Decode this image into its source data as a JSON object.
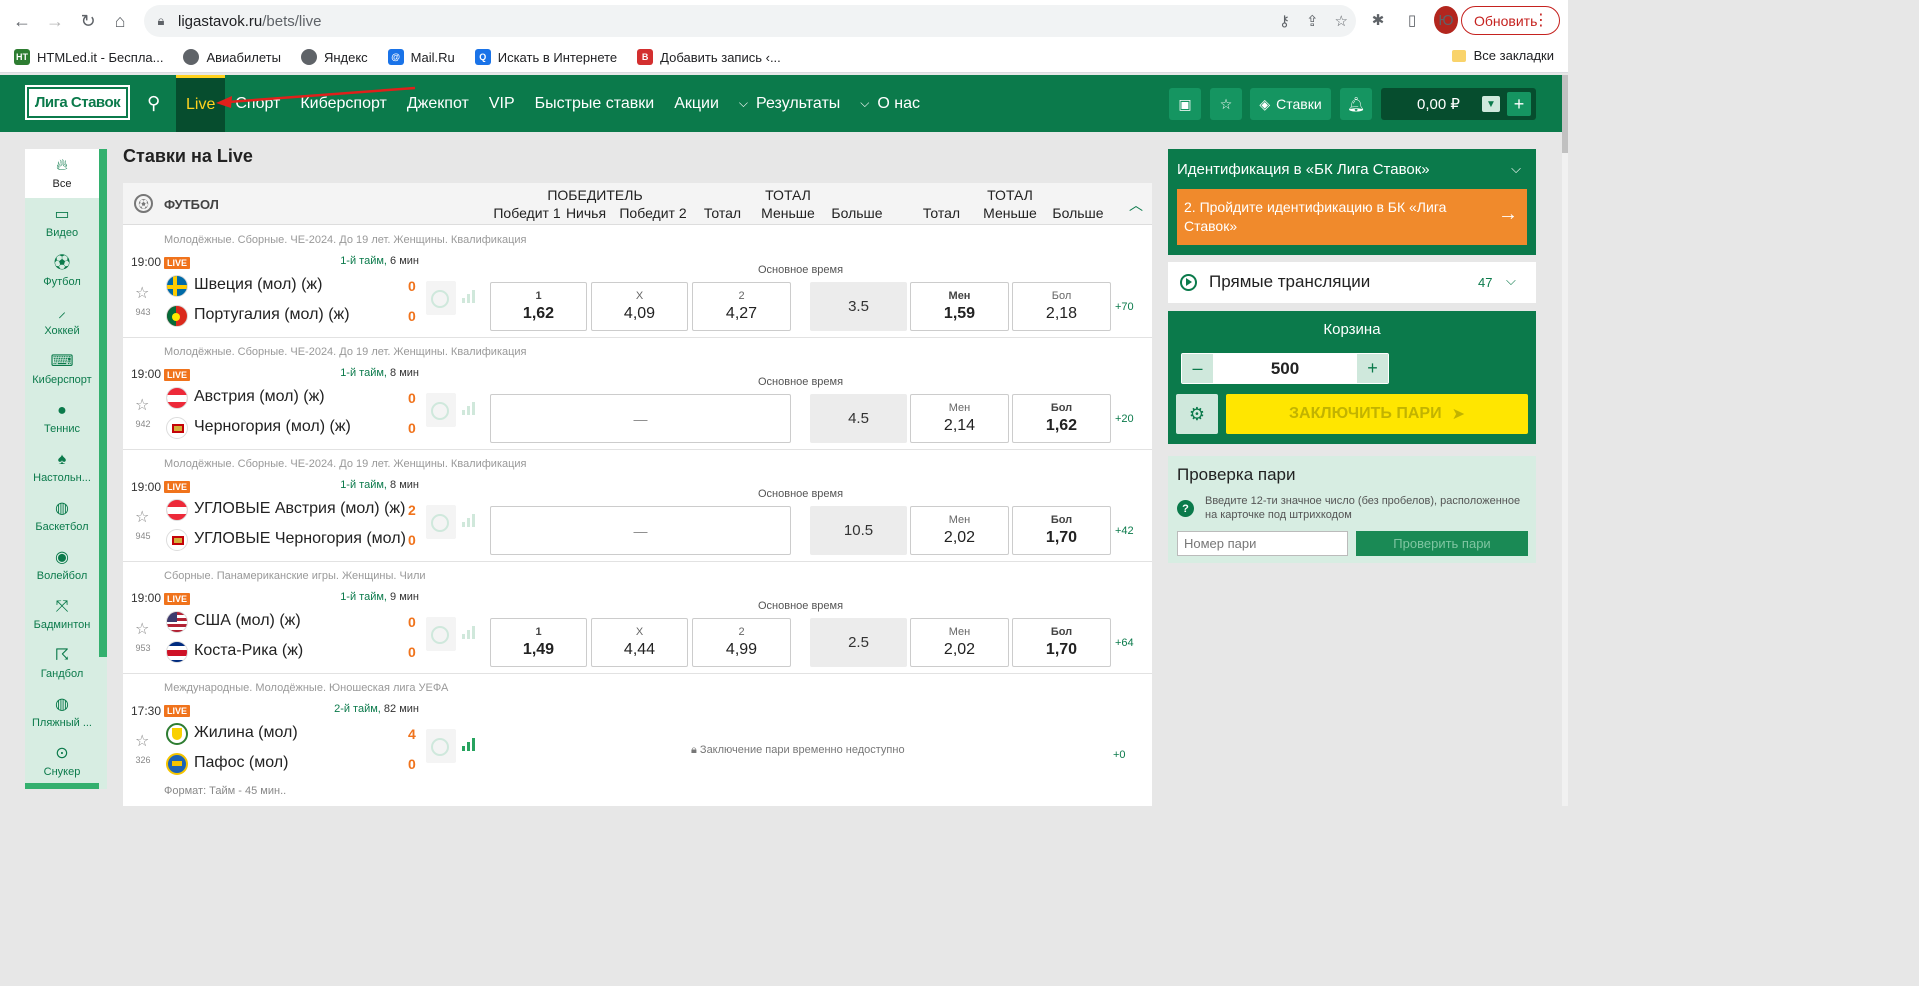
{
  "browser": {
    "url_host": "ligastavok.ru",
    "url_path": "/bets/live",
    "update_label": "Обновить",
    "profile_initial": "Ю",
    "bookmarks": [
      {
        "label": "HTMLed.it - Беспла...",
        "icon": "HT",
        "color": "#2e7d32"
      },
      {
        "label": "Авиабилеты",
        "icon": "globe",
        "color": "#5f6368"
      },
      {
        "label": "Яндекс",
        "icon": "globe",
        "color": "#5f6368"
      },
      {
        "label": "Mail.Ru",
        "icon": "@",
        "color": "#1a73e8"
      },
      {
        "label": "Искать в Интернете",
        "icon": "Q",
        "color": "#1a73e8"
      },
      {
        "label": "Добавить запись ‹...",
        "icon": "B",
        "color": "#d32f2f"
      }
    ],
    "all_bookmarks_label": "Все закладки"
  },
  "header": {
    "logo_text": "Лига Ставок",
    "nav": [
      {
        "label": "Live",
        "active": true
      },
      {
        "label": "Спорт"
      },
      {
        "label": "Киберспорт"
      },
      {
        "label": "Джекпот"
      },
      {
        "label": "VIP"
      },
      {
        "label": "Быстрые ставки"
      },
      {
        "label": "Акции"
      },
      {
        "label": "Результаты",
        "dropdown": true
      },
      {
        "label": "О нас",
        "dropdown": true
      }
    ],
    "bets_label": "Ставки",
    "balance": "0,00 ₽"
  },
  "sidebar": {
    "items": [
      {
        "label": "Все",
        "icon": "fire-icon",
        "active": true
      },
      {
        "label": "Видео",
        "icon": "monitor-icon"
      },
      {
        "label": "Футбол",
        "icon": "football-icon"
      },
      {
        "label": "Хоккей",
        "icon": "hockey-icon"
      },
      {
        "label": "Киберспорт",
        "icon": "gamepad-icon"
      },
      {
        "label": "Теннис",
        "icon": "tennis-icon"
      },
      {
        "label": "Настольн...",
        "icon": "table-tennis-icon"
      },
      {
        "label": "Баскетбол",
        "icon": "basketball-icon"
      },
      {
        "label": "Волейбол",
        "icon": "volleyball-icon"
      },
      {
        "label": "Бадминтон",
        "icon": "badminton-icon"
      },
      {
        "label": "Гандбол",
        "icon": "handball-icon"
      },
      {
        "label": "Пляжный ...",
        "icon": "beach-volleyball-icon"
      },
      {
        "label": "Снукер",
        "icon": "snooker-icon"
      }
    ]
  },
  "main": {
    "title": "Ставки на Live",
    "category": "ФУТБОЛ",
    "columns": {
      "winner_group": "ПОБЕДИТЕЛЬ",
      "win1": "Победит 1",
      "draw": "Ничья",
      "win2": "Победит 2",
      "total_group_1": "ТОТАЛ",
      "total": "Тотал",
      "less": "Меньше",
      "more": "Больше",
      "total_group_2": "ТОТАЛ",
      "total2": "Тотал",
      "less2": "Меньше",
      "more2": "Больше"
    },
    "main_time_label": "Основное время",
    "events": [
      {
        "league": "Молодёжные. Сборные. ЧЕ-2024. До 19 лет. Женщины. Квалификация",
        "time": "19:00",
        "live": "LIVE",
        "period": "1-й тайм,",
        "minute": "6 мин",
        "id": "943",
        "team1": "Швеция (мол) (ж)",
        "team2": "Португалия (мол) (ж)",
        "flag1": "sweden",
        "flag2": "portugal",
        "score1": "0",
        "score2": "0",
        "outcomes": [
          {
            "label": "1",
            "value": "1,62",
            "bold": true
          },
          {
            "label": "X",
            "value": "4,09"
          },
          {
            "label": "2",
            "value": "4,27"
          }
        ],
        "total": "3.5",
        "under": {
          "label": "Мен",
          "value": "1,59",
          "bold": true
        },
        "over": {
          "label": "Бол",
          "value": "2,18"
        },
        "more": "+70"
      },
      {
        "league": "Молодёжные. Сборные. ЧЕ-2024. До 19 лет. Женщины. Квалификация",
        "time": "19:00",
        "live": "LIVE",
        "period": "1-й тайм,",
        "minute": "8 мин",
        "id": "942",
        "team1": "Австрия (мол) (ж)",
        "team2": "Черногория (мол) (ж)",
        "flag1": "austria",
        "flag2": "montenegro",
        "score1": "0",
        "score2": "0",
        "outcomes_empty": "—",
        "total": "4.5",
        "under": {
          "label": "Мен",
          "value": "2,14"
        },
        "over": {
          "label": "Бол",
          "value": "1,62",
          "bold": true
        },
        "more": "+20"
      },
      {
        "league": "Молодёжные. Сборные. ЧЕ-2024. До 19 лет. Женщины. Квалификация",
        "time": "19:00",
        "live": "LIVE",
        "period": "1-й тайм,",
        "minute": "8 мин",
        "id": "945",
        "team1": "УГЛОВЫЕ Австрия (мол) (ж)",
        "team2": "УГЛОВЫЕ Черногория (мол) (...",
        "flag1": "austria",
        "flag2": "montenegro",
        "score1": "2",
        "score2": "0",
        "outcomes_empty": "—",
        "total": "10.5",
        "under": {
          "label": "Мен",
          "value": "2,02"
        },
        "over": {
          "label": "Бол",
          "value": "1,70",
          "bold": true
        },
        "more": "+42"
      },
      {
        "league": "Сборные. Панамериканские игры. Женщины. Чили",
        "time": "19:00",
        "live": "LIVE",
        "period": "1-й тайм,",
        "minute": "9 мин",
        "id": "953",
        "team1": "США (мол) (ж)",
        "team2": "Коста-Рика (ж)",
        "flag1": "usa",
        "flag2": "costarica",
        "score1": "0",
        "score2": "0",
        "outcomes": [
          {
            "label": "1",
            "value": "1,49",
            "bold": true
          },
          {
            "label": "X",
            "value": "4,44"
          },
          {
            "label": "2",
            "value": "4,99"
          }
        ],
        "total": "2.5",
        "under": {
          "label": "Мен",
          "value": "2,02"
        },
        "over": {
          "label": "Бол",
          "value": "1,70",
          "bold": true
        },
        "more": "+64"
      },
      {
        "league": "Международные. Молодёжные. Юношеская лига УЕФА",
        "time": "17:30",
        "live": "LIVE",
        "period": "2-й тайм,",
        "minute": "82 мин",
        "id": "326",
        "team1": "Жилина (мол)",
        "team2": "Пафос (мол)",
        "flag1": "zilina",
        "flag2": "pafos",
        "score1": "4",
        "score2": "0",
        "suspended": "Заключение пари временно недоступно",
        "more": "+0",
        "format": "Формат: Тайм - 45 мин.."
      }
    ]
  },
  "right": {
    "ident_title": "Идентификация в «БК Лига Ставок»",
    "ident_step": "2. Пройдите идентификацию в БК «Лига Ставок»",
    "streams_title": "Прямые трансляции",
    "streams_count": "47",
    "basket_title": "Корзина",
    "stake": "500",
    "place_bet": "ЗАКЛЮЧИТЬ ПАРИ",
    "check_title": "Проверка пари",
    "check_hint": "Введите 12-ти значное число (без пробелов), расположенное на карточке под штрихкодом",
    "check_placeholder": "Номер пари",
    "check_button": "Проверить пари"
  },
  "colors": {
    "brand": "#0b7a4b",
    "accent": "#ffd21f",
    "live": "#f0731c",
    "orange": "#f08a2c",
    "yellow": "#ffe600"
  }
}
